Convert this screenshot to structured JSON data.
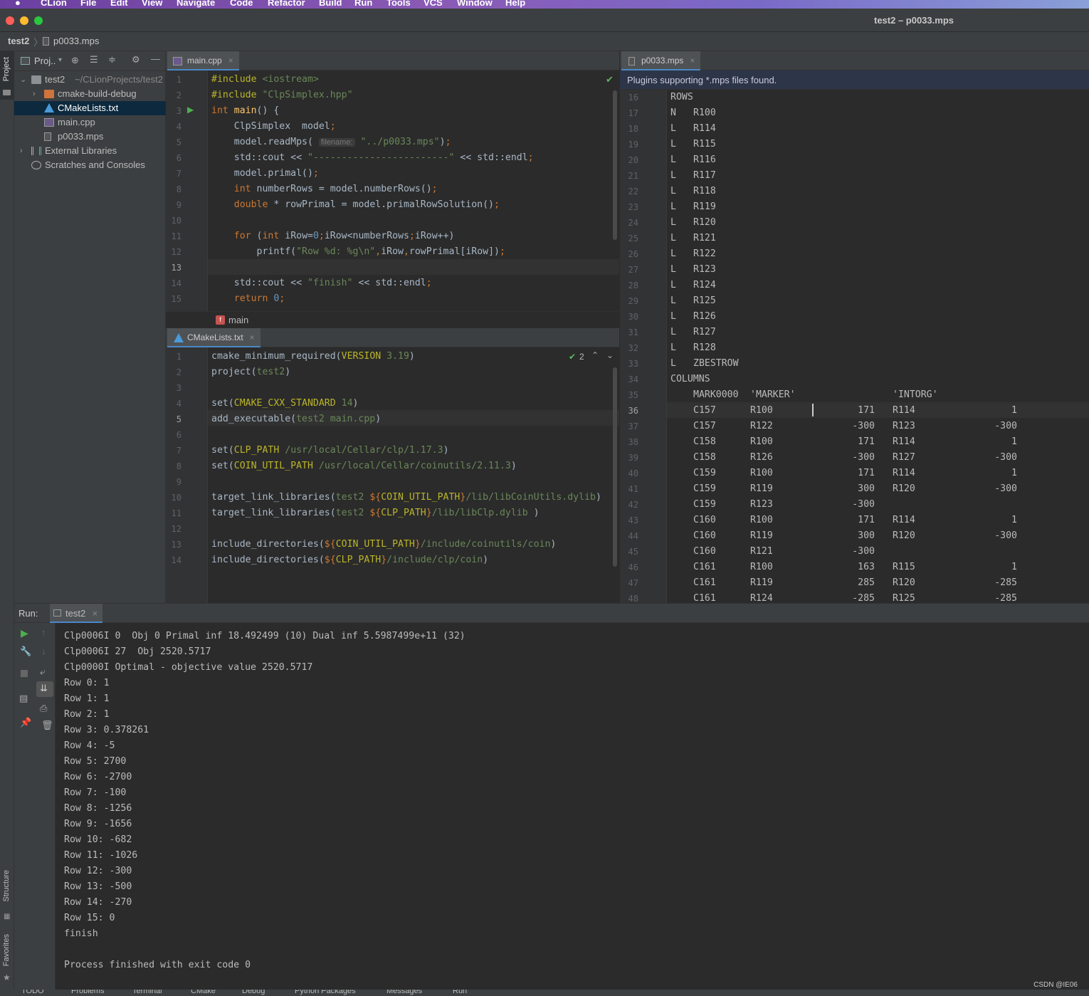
{
  "menubar": {
    "apple": "",
    "items": [
      "CLion",
      "File",
      "Edit",
      "View",
      "Navigate",
      "Code",
      "Refactor",
      "Build",
      "Run",
      "Tools",
      "VCS",
      "Window",
      "Help"
    ]
  },
  "window_title": "test2 – p0033.mps",
  "breadcrumb": {
    "project": "test2",
    "file": "p0033.mps"
  },
  "project_panel": {
    "title": "Proj..",
    "strip_label": "Project",
    "tree": [
      {
        "label": "test2",
        "extra": "~/CLionProjects/test2",
        "indent": 0,
        "icon": "folder-icon",
        "expanded": true
      },
      {
        "label": "cmake-build-debug",
        "indent": 1,
        "icon": "folder-orange-icon",
        "expanded": false
      },
      {
        "label": "CMakeLists.txt",
        "indent": 1,
        "icon": "cmake-icon",
        "selected": true
      },
      {
        "label": "main.cpp",
        "indent": 1,
        "icon": "cpp-file-icon"
      },
      {
        "label": "p0033.mps",
        "indent": 1,
        "icon": "text-file-icon"
      },
      {
        "label": "External Libraries",
        "indent": 0,
        "icon": "library-icon",
        "expanded": false
      },
      {
        "label": "Scratches and Consoles",
        "indent": 0,
        "icon": "scratch-icon"
      }
    ]
  },
  "editor_main": {
    "tab": "main.cpp",
    "breadcrumb_fn": "main",
    "lines": [
      "1",
      "2",
      "3",
      "4",
      "5",
      "6",
      "7",
      "8",
      "9",
      "10",
      "11",
      "12",
      "13",
      "14",
      "15"
    ],
    "current_line": "13",
    "code_html": [
      "<span class=\"mac\">#include</span> <span class=\"str\">&lt;iostream&gt;</span>",
      "<span class=\"mac\">#include</span> <span class=\"str\">\"ClpSimplex.hpp\"</span>",
      "<span class=\"kw\">int</span> <span class=\"fn\">main</span>() {",
      "    ClpSimplex  model<span class=\"kw\">;</span>",
      "    model.readMps( <span class=\"hint\">filename:</span> <span class=\"str\">\"../p0033.mps\"</span>)<span class=\"kw\">;</span>",
      "    std::cout &lt;&lt; <span class=\"str\">\"------------------------\"</span> &lt;&lt; std::endl<span class=\"kw\">;</span>",
      "    model.primal()<span class=\"kw\">;</span>",
      "    <span class=\"kw\">int</span> numberRows = model.numberRows()<span class=\"kw\">;</span>",
      "    <span class=\"kw\">double</span> * rowPrimal = model.primalRowSolution()<span class=\"kw\">;</span>",
      "",
      "    <span class=\"kw\">for</span> (<span class=\"kw\">int</span> iRow=<span class=\"num\">0</span><span class=\"kw\">;</span>iRow&lt;numberRows<span class=\"kw\">;</span>iRow++)",
      "        printf(<span class=\"str\">\"Row %d: %g\\n\"</span><span class=\"kw\">,</span>iRow<span class=\"kw\">,</span>rowPrimal[iRow])<span class=\"kw\">;</span>",
      "",
      "    std::cout &lt;&lt; <span class=\"str\">\"finish\"</span> &lt;&lt; std::endl<span class=\"kw\">;</span>",
      "    <span class=\"kw\">return</span> <span class=\"num\">0</span><span class=\"kw\">;</span>"
    ]
  },
  "editor_cmake": {
    "tab": "CMakeLists.txt",
    "inspection_count": "2",
    "lines": [
      "1",
      "2",
      "3",
      "4",
      "5",
      "6",
      "7",
      "8",
      "9",
      "10",
      "11",
      "12",
      "13",
      "14"
    ],
    "current_line": "5",
    "code_html": [
      "cmake_minimum_required(<span class=\"mac\">VERSION</span> <span class=\"str\">3.19</span>)",
      "project(<span class=\"str\">test2</span>)",
      "",
      "set(<span class=\"mac\">CMAKE_CXX_STANDARD</span> <span class=\"str\">14</span>)",
      "add_executable(<span class=\"str\">test2 main.cpp</span>)",
      "",
      "set(<span class=\"mac\">CLP_PATH</span> <span class=\"str\">/usr/local/Cellar/clp/1.17.3</span>)",
      "set(<span class=\"mac\">COIN_UTIL_PATH</span> <span class=\"str\">/usr/local/Cellar/coinutils/2.11.3</span>)",
      "",
      "target_link_libraries(<span class=\"str\">test2</span> <span class=\"kw\">${</span><span class=\"mac\">COIN_UTIL_PATH</span><span class=\"kw\">}</span><span class=\"str\">/lib/libCoinUtils.dylib</span>)",
      "target_link_libraries(<span class=\"str\">test2</span> <span class=\"kw\">${</span><span class=\"mac\">CLP_PATH</span><span class=\"kw\">}</span><span class=\"str\">/lib/libClp.dylib</span> )",
      "",
      "include_directories(<span class=\"kw\">${</span><span class=\"mac\">COIN_UTIL_PATH</span><span class=\"kw\">}</span><span class=\"str\">/include/coinutils/coin</span>)",
      "include_directories(<span class=\"kw\">${</span><span class=\"mac\">CLP_PATH</span><span class=\"kw\">}</span><span class=\"str\">/include/clp/coin</span>)"
    ]
  },
  "editor_mps": {
    "tab": "p0033.mps",
    "banner": "Plugins supporting *.mps files found.",
    "current_line": "36",
    "rows": [
      {
        "n": "16",
        "c": [
          "ROWS",
          "",
          "",
          "",
          "",
          ""
        ]
      },
      {
        "n": "17",
        "c": [
          "N",
          "R100",
          "",
          "",
          "",
          ""
        ]
      },
      {
        "n": "18",
        "c": [
          "L",
          "R114",
          "",
          "",
          "",
          ""
        ]
      },
      {
        "n": "19",
        "c": [
          "L",
          "R115",
          "",
          "",
          "",
          ""
        ]
      },
      {
        "n": "20",
        "c": [
          "L",
          "R116",
          "",
          "",
          "",
          ""
        ]
      },
      {
        "n": "21",
        "c": [
          "L",
          "R117",
          "",
          "",
          "",
          ""
        ]
      },
      {
        "n": "22",
        "c": [
          "L",
          "R118",
          "",
          "",
          "",
          ""
        ]
      },
      {
        "n": "23",
        "c": [
          "L",
          "R119",
          "",
          "",
          "",
          ""
        ]
      },
      {
        "n": "24",
        "c": [
          "L",
          "R120",
          "",
          "",
          "",
          ""
        ]
      },
      {
        "n": "25",
        "c": [
          "L",
          "R121",
          "",
          "",
          "",
          ""
        ]
      },
      {
        "n": "26",
        "c": [
          "L",
          "R122",
          "",
          "",
          "",
          ""
        ]
      },
      {
        "n": "27",
        "c": [
          "L",
          "R123",
          "",
          "",
          "",
          ""
        ]
      },
      {
        "n": "28",
        "c": [
          "L",
          "R124",
          "",
          "",
          "",
          ""
        ]
      },
      {
        "n": "29",
        "c": [
          "L",
          "R125",
          "",
          "",
          "",
          ""
        ]
      },
      {
        "n": "30",
        "c": [
          "L",
          "R126",
          "",
          "",
          "",
          ""
        ]
      },
      {
        "n": "31",
        "c": [
          "L",
          "R127",
          "",
          "",
          "",
          ""
        ]
      },
      {
        "n": "32",
        "c": [
          "L",
          "R128",
          "",
          "",
          "",
          ""
        ]
      },
      {
        "n": "33",
        "c": [
          "L",
          "ZBESTROW",
          "",
          "",
          "",
          ""
        ]
      },
      {
        "n": "34",
        "c": [
          "COLUMNS",
          "",
          "",
          "",
          "",
          ""
        ]
      },
      {
        "n": "35",
        "c": [
          "",
          "MARK0000",
          "'MARKER'",
          "",
          "'INTORG'",
          ""
        ]
      },
      {
        "n": "36",
        "c": [
          "",
          "C157",
          "R100",
          "171",
          "R114",
          "1"
        ]
      },
      {
        "n": "37",
        "c": [
          "",
          "C157",
          "R122",
          "-300",
          "R123",
          "-300"
        ]
      },
      {
        "n": "38",
        "c": [
          "",
          "C158",
          "R100",
          "171",
          "R114",
          "1"
        ]
      },
      {
        "n": "39",
        "c": [
          "",
          "C158",
          "R126",
          "-300",
          "R127",
          "-300"
        ]
      },
      {
        "n": "40",
        "c": [
          "",
          "C159",
          "R100",
          "171",
          "R114",
          "1"
        ]
      },
      {
        "n": "41",
        "c": [
          "",
          "C159",
          "R119",
          "300",
          "R120",
          "-300"
        ]
      },
      {
        "n": "42",
        "c": [
          "",
          "C159",
          "R123",
          "-300",
          "",
          ""
        ]
      },
      {
        "n": "43",
        "c": [
          "",
          "C160",
          "R100",
          "171",
          "R114",
          "1"
        ]
      },
      {
        "n": "44",
        "c": [
          "",
          "C160",
          "R119",
          "300",
          "R120",
          "-300"
        ]
      },
      {
        "n": "45",
        "c": [
          "",
          "C160",
          "R121",
          "-300",
          "",
          ""
        ]
      },
      {
        "n": "46",
        "c": [
          "",
          "C161",
          "R100",
          "163",
          "R115",
          "1"
        ]
      },
      {
        "n": "47",
        "c": [
          "",
          "C161",
          "R119",
          "285",
          "R120",
          "-285"
        ]
      },
      {
        "n": "48",
        "c": [
          "",
          "C161",
          "R124",
          "-285",
          "R125",
          "-285"
        ]
      }
    ]
  },
  "run": {
    "label": "Run:",
    "tab": "test2",
    "output": [
      "Clp0006I 0  Obj 0 Primal inf 18.492499 (10) Dual inf 5.5987499e+11 (32)",
      "Clp0006I 27  Obj 2520.5717",
      "Clp0000I Optimal - objective value 2520.5717",
      "Row 0: 1",
      "Row 1: 1",
      "Row 2: 1",
      "Row 3: 0.378261",
      "Row 4: -5",
      "Row 5: 2700",
      "Row 6: -2700",
      "Row 7: -100",
      "Row 8: -1256",
      "Row 9: -1656",
      "Row 10: -682",
      "Row 11: -1026",
      "Row 12: -300",
      "Row 13: -500",
      "Row 14: -270",
      "Row 15: 0",
      "finish",
      "",
      "Process finished with exit code 0"
    ]
  },
  "side_labels": {
    "structure": "Structure",
    "favorites": "Favorites"
  },
  "status_tabs": [
    "TODO",
    "Problems",
    "Terminal",
    "CMake",
    "Debug",
    "Python Packages",
    "Messages",
    "Run"
  ],
  "watermark": "CSDN @IE06"
}
